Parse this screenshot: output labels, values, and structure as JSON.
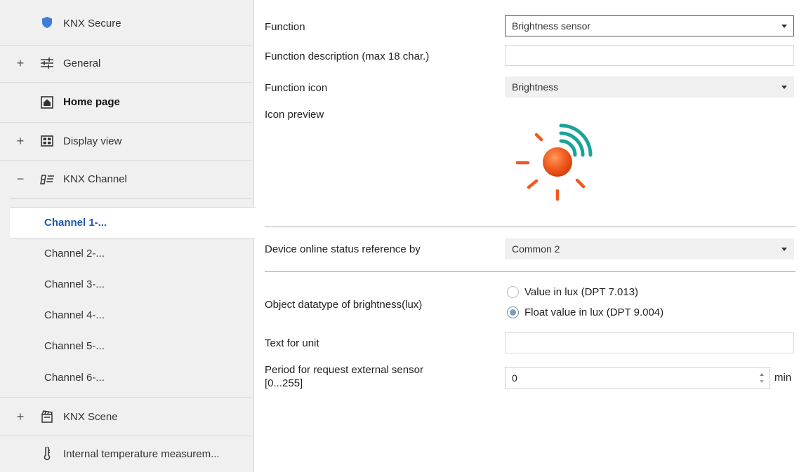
{
  "sidebar": {
    "items": [
      {
        "label": "KNX Secure",
        "expander": "",
        "icon": "shield-icon"
      },
      {
        "label": "General",
        "expander": "+",
        "icon": "sliders-icon"
      },
      {
        "label": "Home page",
        "expander": "",
        "icon": "home-icon"
      },
      {
        "label": "Display view",
        "expander": "+",
        "icon": "grid-icon"
      },
      {
        "label": "KNX Channel",
        "expander": "−",
        "icon": "channel-icon"
      },
      {
        "label": "KNX Scene",
        "expander": "+",
        "icon": "scene-icon"
      },
      {
        "label": "Internal temperature measurem...",
        "expander": "",
        "icon": "thermometer-icon"
      }
    ],
    "channels": [
      "Channel 1-...",
      "Channel 2-...",
      "Channel 3-...",
      "Channel 4-...",
      "Channel 5-...",
      "Channel 6-..."
    ],
    "active_channel": "Channel 1-..."
  },
  "form": {
    "function": {
      "label": "Function",
      "value": "Brightness sensor"
    },
    "description": {
      "label": "Function description (max 18 char.)",
      "value": ""
    },
    "icon": {
      "label": "Function icon",
      "value": "Brightness"
    },
    "preview": {
      "label": "Icon preview",
      "icon": "brightness-icon"
    },
    "online_status": {
      "label": "Device online status reference by",
      "value": "Common 2"
    },
    "datatype": {
      "label": "Object datatype of brightness(lux)",
      "options": [
        "Value in lux (DPT 7.013)",
        "Float value in lux (DPT 9.004)"
      ],
      "selected": "Float value in lux (DPT 9.004)"
    },
    "unit_text": {
      "label": "Text for unit",
      "value": ""
    },
    "period": {
      "label_line1": "Period for request external sensor",
      "label_line2": "[0...255]",
      "value": "0",
      "unit": "min"
    }
  },
  "colors": {
    "sun": "#f05a1e",
    "waves": "#1aa39a",
    "active_text": "#1e5aa8",
    "sidebar_bg": "#f0f0f0"
  }
}
